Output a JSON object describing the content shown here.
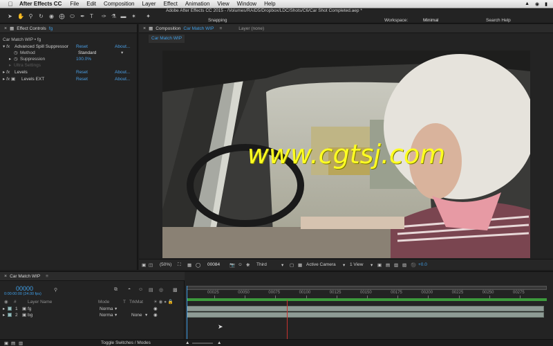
{
  "menubar": {
    "app_name": "After Effects CC",
    "items": [
      "File",
      "Edit",
      "Composition",
      "Layer",
      "Effect",
      "Animation",
      "View",
      "Window",
      "Help"
    ]
  },
  "toolbar": {
    "doc_title": "Adobe After Effects CC 2015 - /Volumes/RAID5/Dropbox/LDC/Shots/C6/Car Shot Completed.aep *",
    "snapping": "Snapping",
    "workspace_label": "Workspace:",
    "workspace_value": "Minimal",
    "search_help": "Search Help"
  },
  "effect_controls": {
    "tab_prefix": "Effect Controls",
    "tab_layer": "fg",
    "breadcrumb": "Car Match WIP • fg",
    "effects": [
      {
        "name": "Advanced Spill Suppressor",
        "reset": "Reset",
        "about": "About..."
      },
      {
        "name": "Levels",
        "reset": "Reset",
        "about": "About..."
      },
      {
        "name": "Levels EXT",
        "reset": "Reset",
        "about": "About..."
      }
    ],
    "method_label": "Method",
    "method_value": "Standard",
    "suppression_label": "Suppression",
    "suppression_value": "100.0%",
    "ultra_settings": "Ultra Settings"
  },
  "composition": {
    "tab_prefix": "Composition",
    "tab_name": "Car Match WIP",
    "layer_tab": "Layer (none)",
    "sub_tab": "Car Match WIP",
    "watermark": "www.cgtsj.com",
    "bottom": {
      "zoom": "(50%)",
      "frame": "00084",
      "resolution": "Third",
      "camera": "Active Camera",
      "views": "1 View",
      "exposure": "+0.0"
    }
  },
  "timeline": {
    "tab_name": "Car Match WIP",
    "current_time": "00000",
    "time_sub": "0:00:00:00 (24.00 fps)",
    "headers": {
      "layer_name": "Layer Name",
      "mode": "Mode",
      "t": "T",
      "trkmat": "TrkMat"
    },
    "ruler": [
      "00025",
      "00050",
      "00075",
      "00100",
      "00125",
      "00150",
      "00175",
      "00200",
      "00225",
      "00250",
      "00275"
    ],
    "layers": [
      {
        "num": "1",
        "name": "fg",
        "mode": "Norma",
        "trkmat": ""
      },
      {
        "num": "2",
        "name": "bg",
        "mode": "Norma",
        "trkmat": "None"
      }
    ],
    "toggle_label": "Toggle Switches / Modes"
  },
  "colors": {
    "accent_blue": "#3f9fe8",
    "playhead_red": "#c8332f",
    "watermark_yellow": "#ffff22",
    "panel_bg": "#232323"
  },
  "icons": [
    "apple-icon",
    "selection-tool-icon",
    "hand-tool-icon",
    "zoom-tool-icon",
    "rotate-tool-icon",
    "camera-tool-icon",
    "pan-behind-tool-icon",
    "mask-tool-icon",
    "pen-tool-icon",
    "text-tool-icon",
    "brush-tool-icon",
    "clone-stamp-tool-icon",
    "eraser-tool-icon",
    "roto-brush-tool-icon",
    "puppet-pin-tool-icon"
  ]
}
